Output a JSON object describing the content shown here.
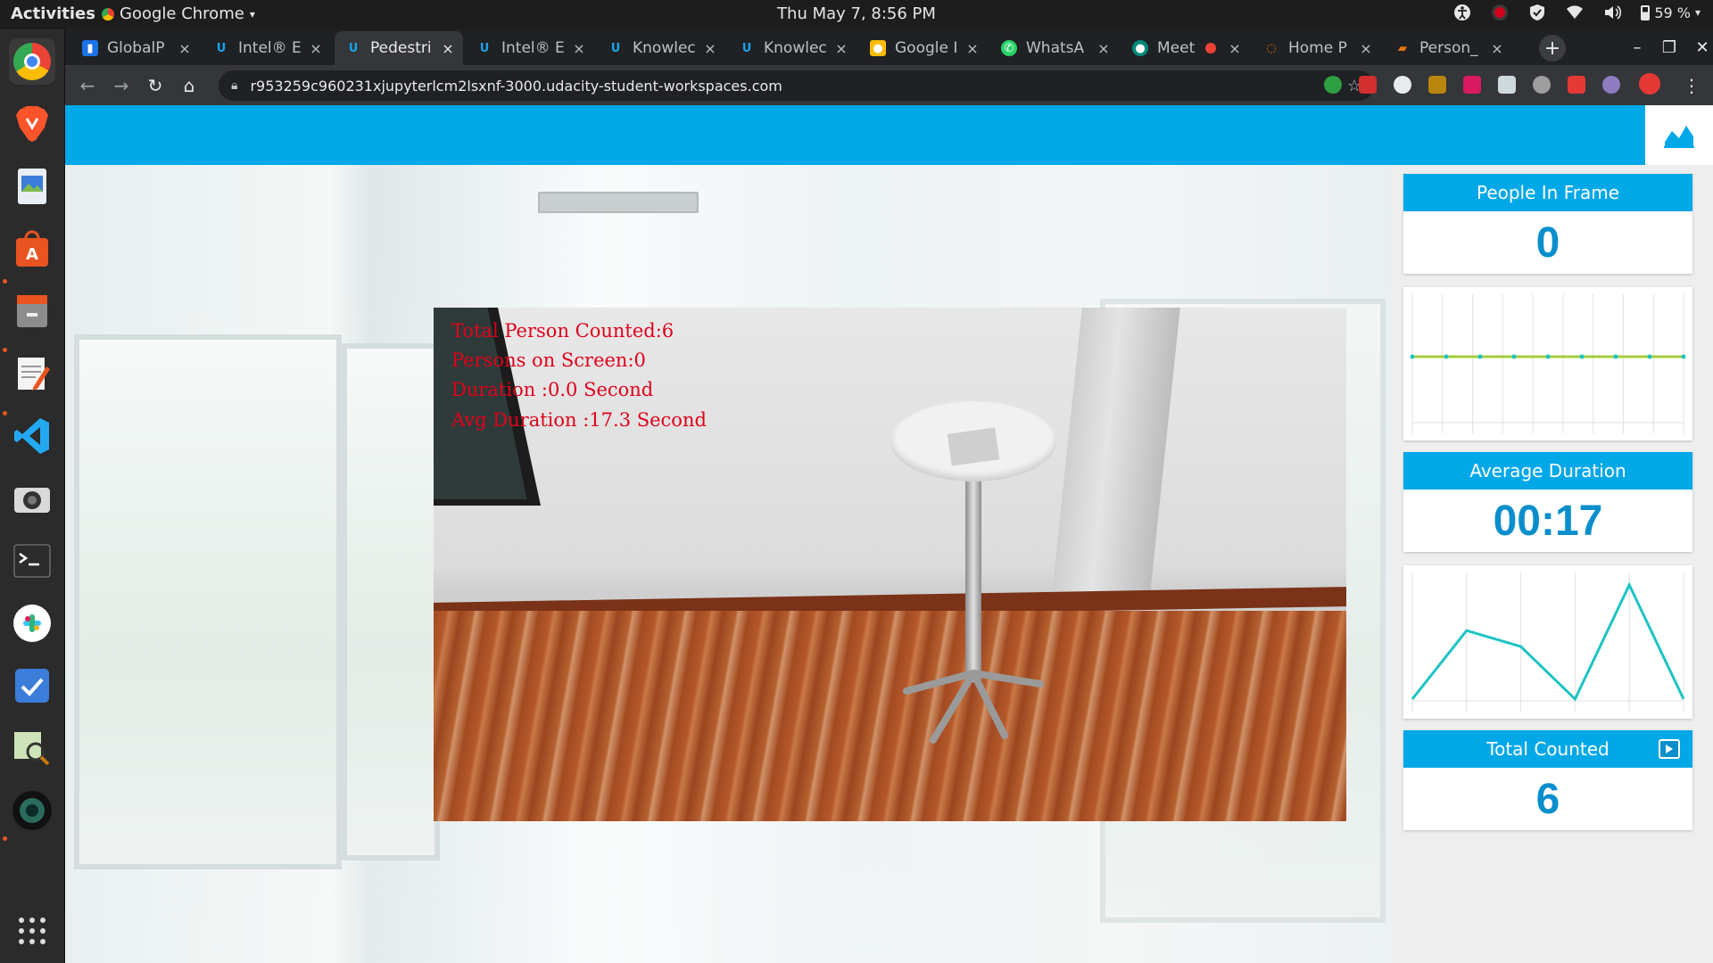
{
  "system_bar": {
    "activities": "Activities",
    "app_name": "Google Chrome",
    "clock": "Thu May  7,  8:56 PM",
    "battery": "59 %"
  },
  "browser": {
    "tabs": [
      {
        "label": "GlobalP",
        "favicon": "#1a73e8",
        "active": false
      },
      {
        "label": "Intel® E",
        "favicon": "#1aa3e8",
        "active": false
      },
      {
        "label": "Pedestri",
        "favicon": "#1aa3e8",
        "active": true
      },
      {
        "label": "Intel® E",
        "favicon": "#1aa3e8",
        "active": false
      },
      {
        "label": "Knowlec",
        "favicon": "#1aa3e8",
        "active": false
      },
      {
        "label": "Knowlec",
        "favicon": "#1aa3e8",
        "active": false
      },
      {
        "label": "Google I",
        "favicon": "#fbbc04",
        "active": false
      },
      {
        "label": "WhatsA",
        "favicon": "#25d366",
        "active": false
      },
      {
        "label": "Meet",
        "favicon": "#00897b",
        "active": false
      },
      {
        "label": "Home P",
        "favicon": "#e8710a",
        "active": false
      },
      {
        "label": "Person_",
        "favicon": "#e8710a",
        "active": false
      }
    ],
    "url": "r953259c960231xjupyterlcm2lsxnf-3000.udacity-student-workspaces.com"
  },
  "video_overlay": {
    "line1": "Total Person Counted:6",
    "line2": "Persons on Screen:0",
    "line3": "Duration :0.0 Second",
    "line4": "Avg Duration :17.3 Second"
  },
  "stats": {
    "people_in_frame_label": "People In Frame",
    "people_in_frame_value": "0",
    "average_duration_label": "Average Duration",
    "average_duration_value": "00:17",
    "total_counted_label": "Total Counted",
    "total_counted_value": "6"
  },
  "chart_data": [
    {
      "type": "line",
      "title": "",
      "x": [
        0,
        1,
        2,
        3,
        4,
        5,
        6,
        7,
        8
      ],
      "y": [
        0,
        0,
        0,
        0,
        0,
        0,
        0,
        0,
        0
      ],
      "color": "#a6ce39",
      "grid": true
    },
    {
      "type": "line",
      "title": "",
      "x": [
        0,
        1,
        2,
        3,
        4,
        5
      ],
      "y": [
        0,
        0.6,
        0.46,
        0,
        1.0,
        0
      ],
      "color": "#1ec3c3",
      "grid": true
    }
  ],
  "colors": {
    "brand_blue": "#00a8e8",
    "value_blue": "#0a8fcc",
    "overlay_red": "#e0001a"
  }
}
